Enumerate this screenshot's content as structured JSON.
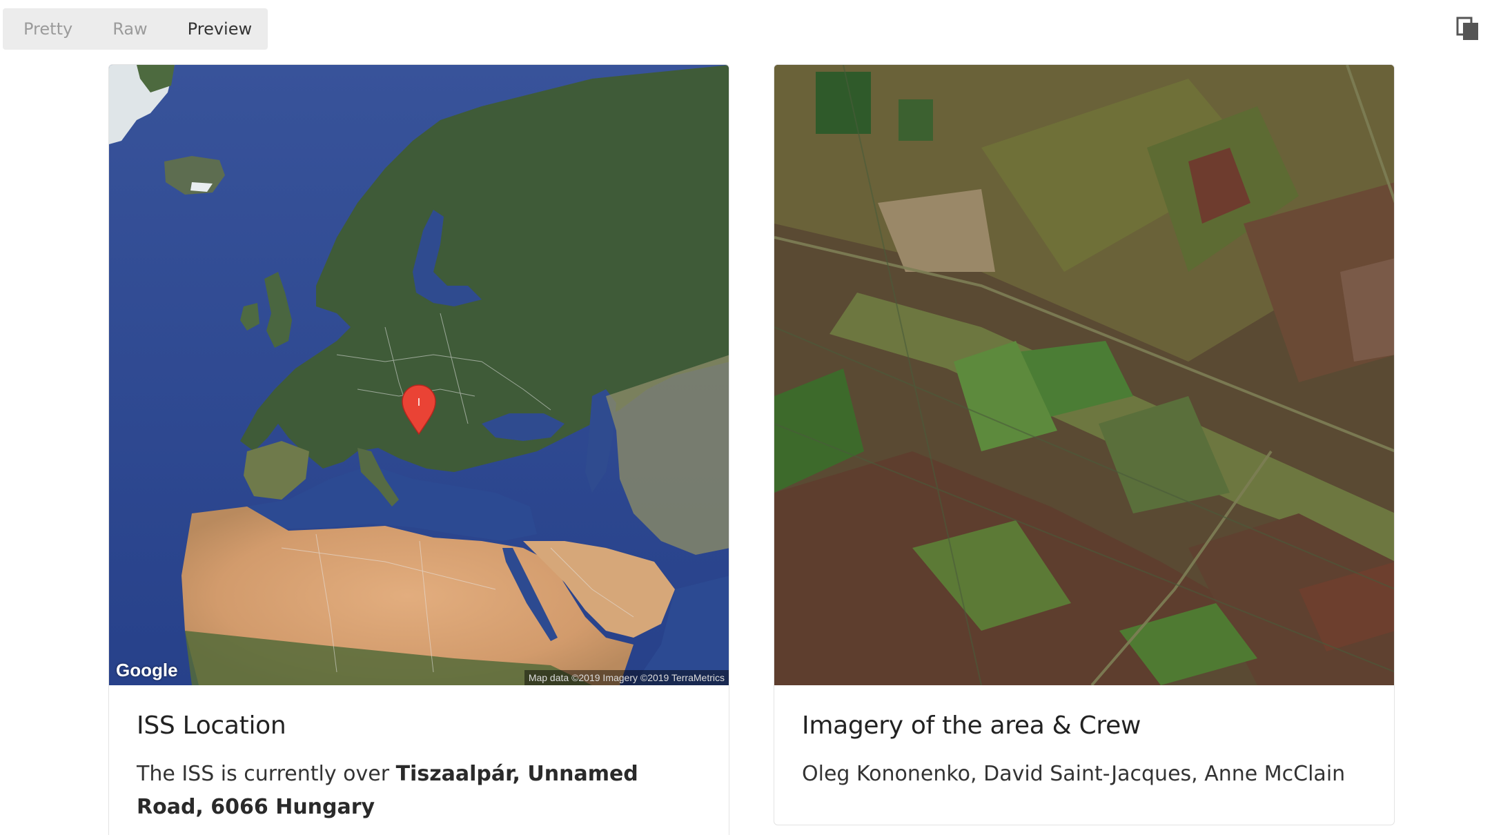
{
  "toolbar": {
    "tabs": [
      {
        "label": "Pretty",
        "active": false
      },
      {
        "label": "Raw",
        "active": false
      },
      {
        "label": "Preview",
        "active": true
      }
    ],
    "copy_icon": "copy-icon"
  },
  "location_card": {
    "title": "ISS Location",
    "text_prefix": "The ISS is currently over ",
    "place": "Tiszaalpár, Unnamed Road, 6066 Hungary",
    "map": {
      "brand": "Google",
      "attribution": "Map data ©2019  Imagery ©2019 TerraMetrics",
      "marker_label": "I",
      "marker_color": "#ea4335"
    }
  },
  "imagery_card": {
    "title": "Imagery of the area & Crew",
    "crew": "Oleg Kononenko, David Saint-Jacques, Anne McClain"
  },
  "colors": {
    "toggle_bg": "#ececec",
    "active_tab": "#333333",
    "inactive_tab": "#9b9b9b",
    "card_border": "#e3e3e3"
  }
}
